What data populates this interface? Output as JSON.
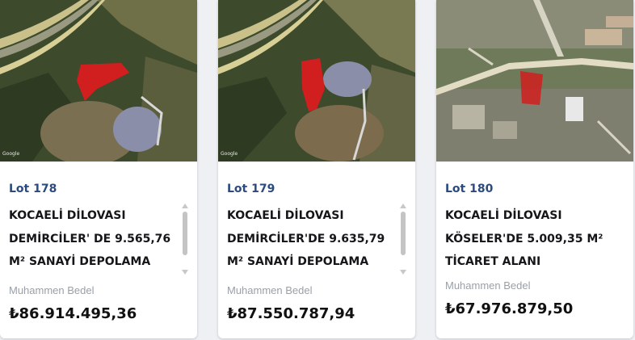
{
  "cards": [
    {
      "lot": "Lot 178",
      "title": "KOCAELİ DİLOVASI\nDEMİRCİLER' DE 9.565,76\nM² SANAYİ DEPOLAMA",
      "meta_label": "Muhammen Bedel",
      "price": "₺86.914.495,36",
      "map_credit": "Google"
    },
    {
      "lot": "Lot 179",
      "title": "KOCAELİ DİLOVASI\nDEMİRCİLER'DE 9.635,79\nM² SANAYİ DEPOLAMA",
      "meta_label": "Muhammen Bedel",
      "price": "₺87.550.787,94",
      "map_credit": "Google"
    },
    {
      "lot": "Lot 180",
      "title": "KOCAELİ DİLOVASI\nKÖSELER'DE 5.009,35 M²\nTİCARET ALANI",
      "meta_label": "Muhammen Bedel",
      "price": "₺67.976.879,50"
    }
  ],
  "colors": {
    "lot_accent": "#2b4a7e",
    "parcel_red": "#d11f1f",
    "page_bg": "#eef0f3"
  }
}
